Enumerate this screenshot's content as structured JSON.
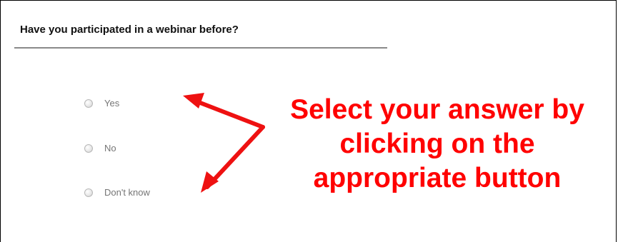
{
  "survey": {
    "question": "Have you participated in a webinar before?",
    "options": [
      {
        "label": "Yes"
      },
      {
        "label": "No"
      },
      {
        "label": "Don't know"
      }
    ]
  },
  "callout": {
    "lines": [
      "Select your answer by",
      "clicking on the",
      "appropriate button"
    ],
    "color": "#ff0000"
  }
}
